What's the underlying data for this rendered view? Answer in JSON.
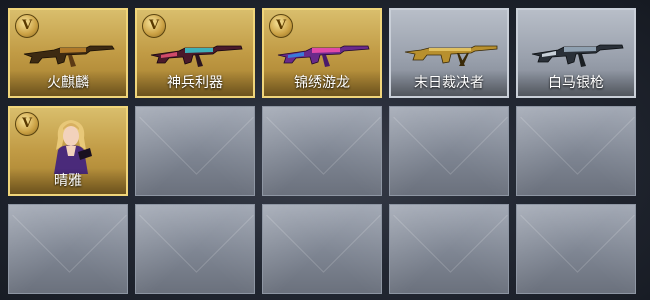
{
  "colors": {
    "gold_slot": "#c9a24a",
    "gold_border": "#f0d57a",
    "silver_slot": "#9aa1ad",
    "empty_slot": "#858c99",
    "label_text": "#ffffff"
  },
  "slots": [
    {
      "name": "火麒麟",
      "rarity": "gold",
      "badge": "V",
      "item": "rifle"
    },
    {
      "name": "神兵利器",
      "rarity": "gold",
      "badge": "V",
      "item": "rifle"
    },
    {
      "name": "锦绣游龙",
      "rarity": "gold",
      "badge": "V",
      "item": "rifle"
    },
    {
      "name": "末日裁决者",
      "rarity": "silver",
      "badge": "",
      "item": "machine-gun"
    },
    {
      "name": "白马银枪",
      "rarity": "silver",
      "badge": "",
      "item": "rifle"
    },
    {
      "name": "晴雅",
      "rarity": "gold",
      "badge": "V",
      "item": "character"
    }
  ]
}
